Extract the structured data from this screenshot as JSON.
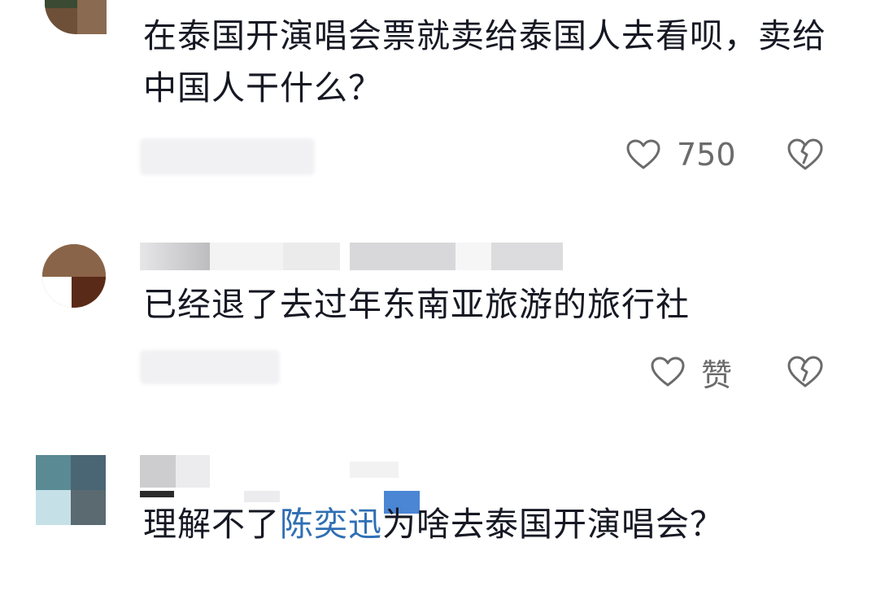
{
  "comments": [
    {
      "text": "在泰国开演唱会票就卖给泰国人去看呗，卖给中国人干什么？",
      "like_label": "750",
      "colors": {
        "avatar": "#7a5a42"
      }
    },
    {
      "text": "已经退了去过年东南亚旅游的旅行社",
      "like_label": "赞",
      "colors": {
        "avatar": "#5c3c2a"
      }
    },
    {
      "text_before": "理解不了",
      "mention": "陈奕迅",
      "text_after": "为啥去泰国开演唱会？",
      "colors": {
        "avatar": "#4c7480",
        "mention": "#2f6fb4"
      }
    }
  ],
  "icons": {
    "like": "heart-outline-icon",
    "dislike": "broken-heart-icon"
  }
}
